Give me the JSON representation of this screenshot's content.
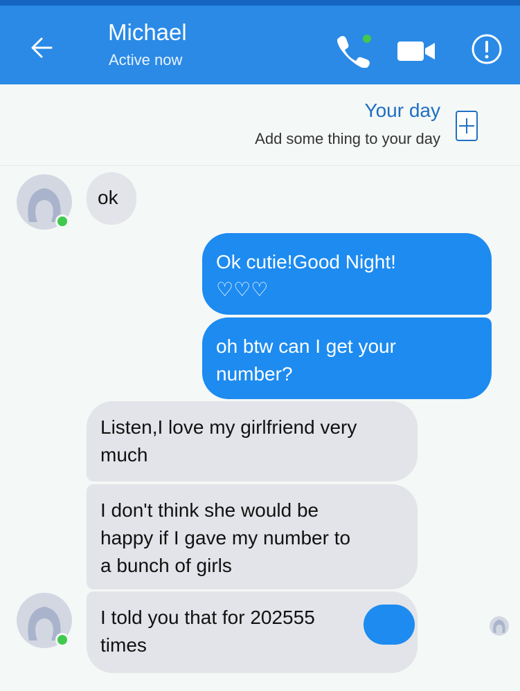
{
  "header": {
    "contact_name": "Michael",
    "status": "Active now",
    "icons": [
      "back-arrow-icon",
      "phone-call-icon",
      "video-camera-icon",
      "info-icon"
    ],
    "color": "#2a8ae6"
  },
  "your_day": {
    "title": "Your day",
    "subtitle": "Add some thing to your day",
    "icon": "plus-icon"
  },
  "messages": [
    {
      "side": "incoming",
      "text": "ok"
    },
    {
      "side": "outgoing",
      "text": "Ok cutie!Good Night!",
      "emoji": "♡♡♡"
    },
    {
      "side": "outgoing",
      "line1": "oh btw can I get your",
      "line2": "number?"
    },
    {
      "side": "incoming",
      "line1": "Listen,I love my girlfriend very",
      "line2": "much"
    },
    {
      "side": "incoming",
      "line1": "I don't think she would be",
      "line2": "happy if I gave my number to",
      "line3": "a bunch of girls"
    },
    {
      "side": "incoming",
      "line1": "I told you that for 202555",
      "line2": "times"
    }
  ],
  "colors": {
    "outgoing_bubble": "#1d8bf0",
    "incoming_bubble": "#e3e4e9",
    "online_dot": "#41c94f"
  }
}
